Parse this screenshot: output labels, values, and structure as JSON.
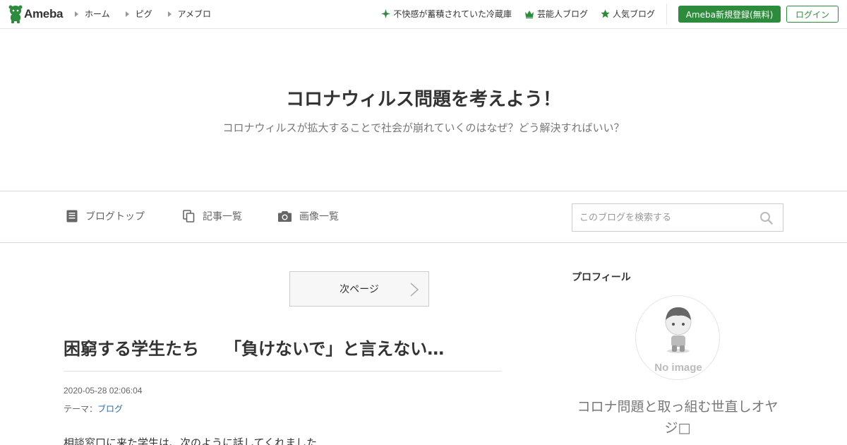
{
  "topbar": {
    "logo_text": "Ameba",
    "nav": [
      "ホーム",
      "ピグ",
      "アメブロ"
    ],
    "links": [
      {
        "label": "不快感が蓄積されていた冷蔵庫",
        "icon": "sparkle-icon"
      },
      {
        "label": "芸能人ブログ",
        "icon": "crown-icon"
      },
      {
        "label": "人気ブログ",
        "icon": "star-icon"
      }
    ],
    "register_label": "Ameba新規登録(無料)",
    "login_label": "ログイン"
  },
  "header": {
    "title": "コロナウィルス問題を考えよう！",
    "description": "コロナウィルスが拡大することで社会が崩れていくのはなぜ？どう解決すればいい？"
  },
  "blognav": {
    "items": [
      {
        "label": "ブログトップ",
        "icon": "document-icon"
      },
      {
        "label": "記事一覧",
        "icon": "copy-icon"
      },
      {
        "label": "画像一覧",
        "icon": "camera-icon"
      }
    ],
    "search_placeholder": "このブログを検索する"
  },
  "main": {
    "next_page_label": "次ページ",
    "article": {
      "title": "困窮する学生たち　　「負けないで」と言えない…",
      "date": "2020-05-28 02:06:04",
      "theme_label": "テーマ：",
      "theme_value": "ブログ",
      "body_first_line": "相談窓口に来た学生は、次のように話してくれました"
    }
  },
  "sidebar": {
    "profile_heading": "プロフィール",
    "avatar_text": "No image",
    "profile_name": "コロナ問題と取っ組む世直しオヤジ□"
  },
  "colors": {
    "brand_green": "#2d8c3c",
    "link_blue": "#2b6cb0"
  }
}
